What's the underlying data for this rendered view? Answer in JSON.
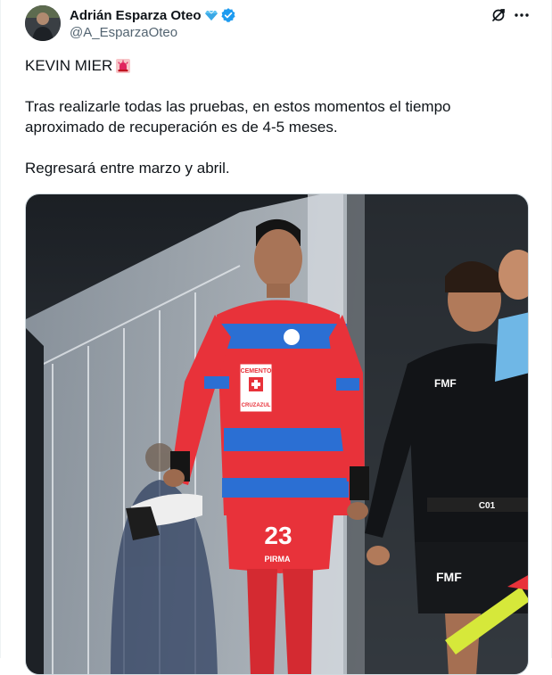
{
  "author": {
    "display_name": "Adrián Esparza Oteo",
    "handle": "@A_EsparzaOteo",
    "badge_icons": [
      "gem-icon",
      "verified-icon"
    ]
  },
  "header_actions": {
    "grok_icon": "grok-icon",
    "more_icon": "more-options-icon"
  },
  "tweet": {
    "headline": "KEVIN MIER",
    "headline_emoji": "siren-icon",
    "paragraph_1_line_1": "Tras realizarle todas las pruebas, en estos momentos el tiempo",
    "paragraph_1_line_2": "aproximado de recuperación es de 4-5 meses.",
    "paragraph_2": "Regresará entre marzo y abril."
  },
  "media": {
    "jersey_sponsor_top": "CEMENTO",
    "jersey_sponsor_bottom": "CRUZAZUL",
    "jersey_number": "23",
    "shorts_brand": "PIRMA",
    "referee_badge": "FMF",
    "referee_shorts_badge": "FMF",
    "referee_belt_label": "C01"
  },
  "colors": {
    "text": "#0f1419",
    "secondary_text": "#536471",
    "verified_blue": "#1d9bf0",
    "border": "#cfd9de",
    "jersey_red": "#e8323a",
    "jersey_blue": "#2b6fd3"
  }
}
